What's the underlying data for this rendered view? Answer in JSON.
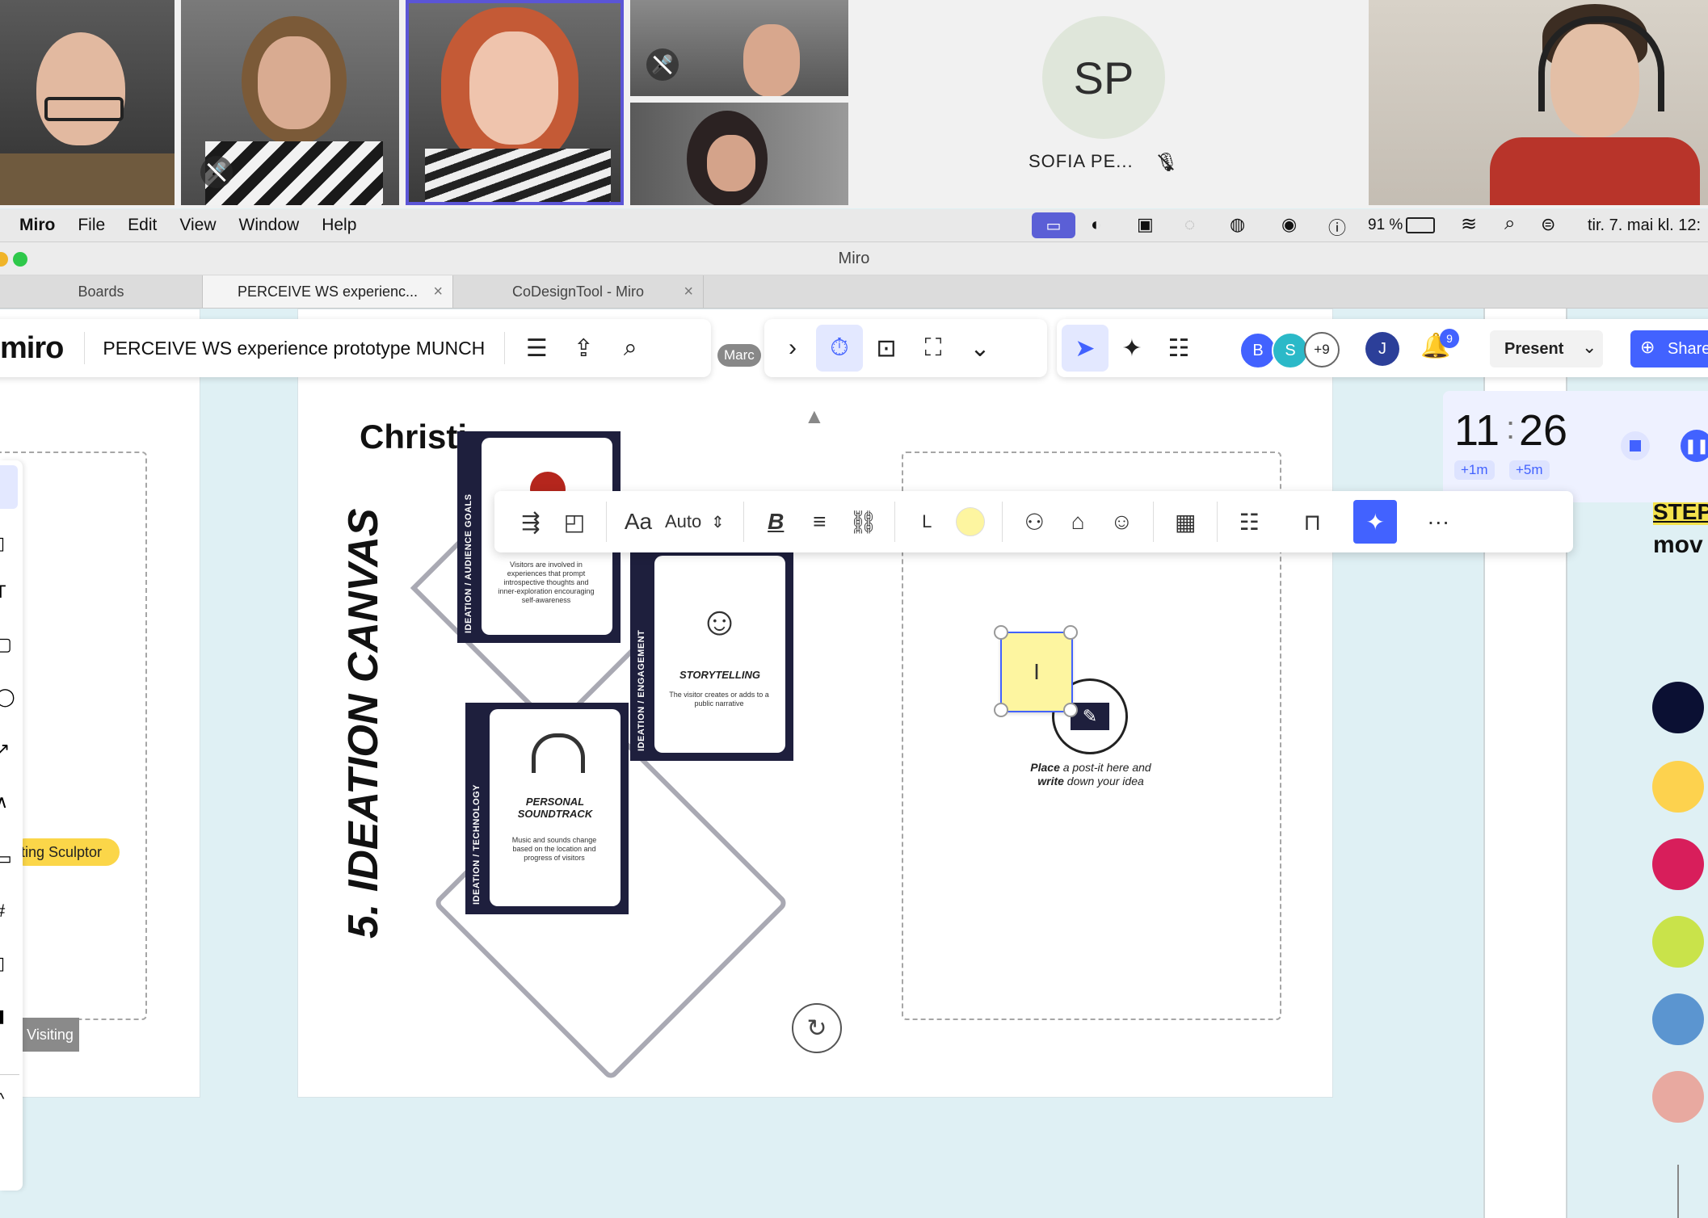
{
  "video_call": {
    "participant_initials": "SP",
    "participant_name": "SOFIA PE..."
  },
  "menubar": {
    "app": "Miro",
    "items": [
      "File",
      "Edit",
      "View",
      "Window",
      "Help"
    ],
    "battery": "91 %",
    "datetime": "tir. 7. mai kl. 12:"
  },
  "window_title": "Miro",
  "browser_tabs": [
    "Boards",
    "PERCEIVE WS experienc...",
    "CoDesignTool - Miro"
  ],
  "topbar": {
    "logo": "miro",
    "board_title": "PERCEIVE WS experience prototype MUNCH",
    "cursor_label": "Marc",
    "avatars": [
      "B",
      "S",
      "+9",
      "J"
    ],
    "notification_count": "9",
    "present_label": "Present",
    "share_label": "Share"
  },
  "timer": {
    "time_min": "11",
    "time_sec": "26",
    "add1": "+1m",
    "add5": "+5m"
  },
  "format_toolbar": {
    "font_size": "Auto",
    "size_letter": "L",
    "colors": {
      "sticky": "#fdf5a0"
    }
  },
  "canvas": {
    "section_title": "5. IDEATION CANVAS",
    "heading": "Christi",
    "card_goals_side": "IDEATION / AUDIENCE GOALS",
    "card_goals_text": "Visitors are involved in experiences that prompt introspective thoughts and inner-exploration encouraging self-awareness",
    "card_story_side": "IDEATION / ENGAGEMENT",
    "card_story_title": "STORYTELLING",
    "card_story_text": "The visitor creates or adds to a public narrative",
    "card_sound_side": "IDEATION / TECHNOLOGY",
    "card_sound_title": "PERSONAL SOUNDTRACK",
    "card_sound_text": "Music and sounds change based on the location and progress of visitors",
    "placeholder_bold1": "Place",
    "placeholder_rest1": " a post-it here and",
    "placeholder_bold2": "write",
    "placeholder_rest2": " down your idea",
    "left_tag": "ting Sculptor",
    "left_label": "Visiting",
    "right_step": "STEP",
    "right_move": "mov"
  },
  "palette": [
    "#0b1033",
    "#fdd24e",
    "#d81e5b",
    "#c9e34a",
    "#5b95d0",
    "#e8a9a0"
  ]
}
